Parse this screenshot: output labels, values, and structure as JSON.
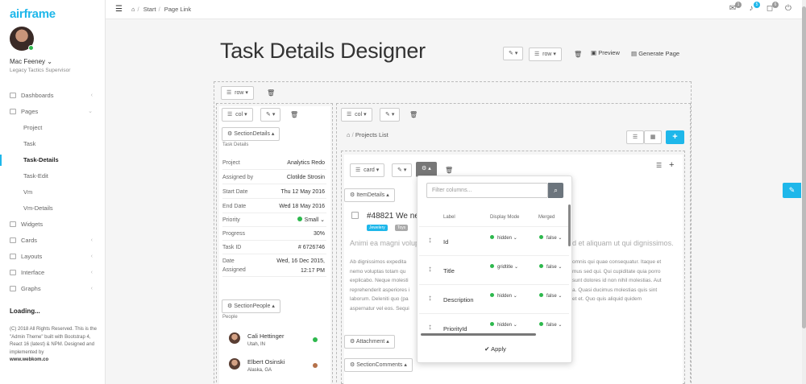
{
  "brand": "airframe",
  "user": {
    "name": "Mac Feeney",
    "title": "Legacy Tactics Supervisor"
  },
  "nav": [
    {
      "label": "Dashboards",
      "chev": "‹"
    },
    {
      "label": "Pages",
      "chev": "⌄"
    }
  ],
  "nav_sub": [
    "Project",
    "Task",
    "Task-Details",
    "Task-Edit",
    "Vm",
    "Vm-Details"
  ],
  "nav_more": [
    {
      "label": "Widgets",
      "chev": ""
    },
    {
      "label": "Cards",
      "chev": "‹"
    },
    {
      "label": "Layouts",
      "chev": "‹"
    },
    {
      "label": "Interface",
      "chev": "‹"
    },
    {
      "label": "Graphs",
      "chev": "‹"
    }
  ],
  "loading": "Loading...",
  "footer": {
    "line1": "(C) 2018 All Rights Reserved. This is the \"Admin Theme\" built with Bootstrap 4, React 16 (latest) & NPM. Designed and implemented by",
    "link": "www.webkom.co"
  },
  "topbar": {
    "crumb1": "Start",
    "crumb2": "Page Link",
    "badges": [
      "1",
      "5",
      "6"
    ]
  },
  "page": {
    "title": "Task Details Designer",
    "row_label": "row",
    "preview": "Preview",
    "generate": "Generate Page"
  },
  "layout": {
    "row_label": "row",
    "col_label": "col",
    "card_label": "card"
  },
  "section_details": {
    "button": "SectionDetails",
    "caption": "Task Details",
    "rows": [
      {
        "k": "Project",
        "v": "Analytics Redo"
      },
      {
        "k": "Assigned by",
        "v": "Clotilde Strosin"
      },
      {
        "k": "Start Date",
        "v": "Thu 12 May 2016"
      },
      {
        "k": "End Date",
        "v": "Wed 18 May 2016"
      },
      {
        "k": "Priority",
        "v": "Small"
      },
      {
        "k": "Progress",
        "v": "30%"
      },
      {
        "k": "Task ID",
        "v": "# 6726746"
      }
    ],
    "date_assigned_k1": "Date",
    "date_assigned_k2": "Assigned",
    "date_assigned_v1": "Wed, 16 Dec 2015,",
    "date_assigned_v2": "12:17 PM"
  },
  "section_people": {
    "button": "SectionPeople",
    "caption": "People",
    "people": [
      {
        "name": "Cali Hettinger",
        "loc": "Utah, IN",
        "status_color": "#2db84d"
      },
      {
        "name": "Elbert Osinski",
        "loc": "Alaska, GA",
        "status_color": "#b5714a"
      }
    ]
  },
  "projects_crumb": "Projects List",
  "item": {
    "button": "ItemDetails",
    "number": "#48821",
    "title_visible": "We ne",
    "tags": [
      "Jewelery",
      "Toys"
    ],
    "lead_left": "Animi ea magni volupt",
    "lead_right": "d et aliquam ut qui dignissimos.",
    "text_left": [
      "Ab dignissimos expedita",
      "nemo voluptas totam qu",
      "explicabo. Neque molesti",
      "reprehenderit asperiores i",
      "laborum. Deleniti quo (pa",
      "aspernatur vel eos. Sequi"
    ],
    "text_right": [
      "omnis qui quae consequatur. Itaque et",
      "mus sed qui. Qui cupiditate quia porro",
      "sunt dolores id non nihil molestias. Aut",
      "a. Quasi ducimus molestias quis sint",
      "et et. Quo quis aliquid quidem",
      ""
    ]
  },
  "attachment": "Attachment",
  "section_comments": "SectionComments",
  "columns_dropdown": {
    "placeholder": "Filter columns...",
    "headers": {
      "label": "Label",
      "display_mode": "Display Mode",
      "merged": "Merged"
    },
    "rows": [
      {
        "label": "Id",
        "mode": "hidden",
        "merged": "false"
      },
      {
        "label": "Title",
        "mode": "gridtitle",
        "merged": "false"
      },
      {
        "label": "Description",
        "mode": "hidden",
        "merged": "false"
      },
      {
        "label": "PriorityId",
        "mode": "hidden",
        "merged": "false"
      }
    ],
    "apply": "Apply"
  },
  "colors": {
    "accent": "#1eb7ea",
    "status_green": "#2db84d"
  }
}
